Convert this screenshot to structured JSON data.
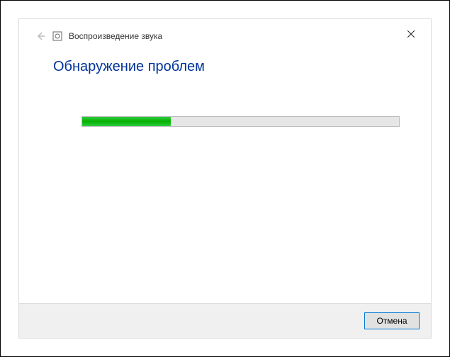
{
  "titlebar": {
    "title": "Воспроизведение звука"
  },
  "content": {
    "heading": "Обнаружение проблем"
  },
  "progress": {
    "percent": 28
  },
  "footer": {
    "cancel_label": "Отмена"
  },
  "colors": {
    "heading": "#003399",
    "progress_fill": "#06b000",
    "focus_border": "#0078d7"
  }
}
